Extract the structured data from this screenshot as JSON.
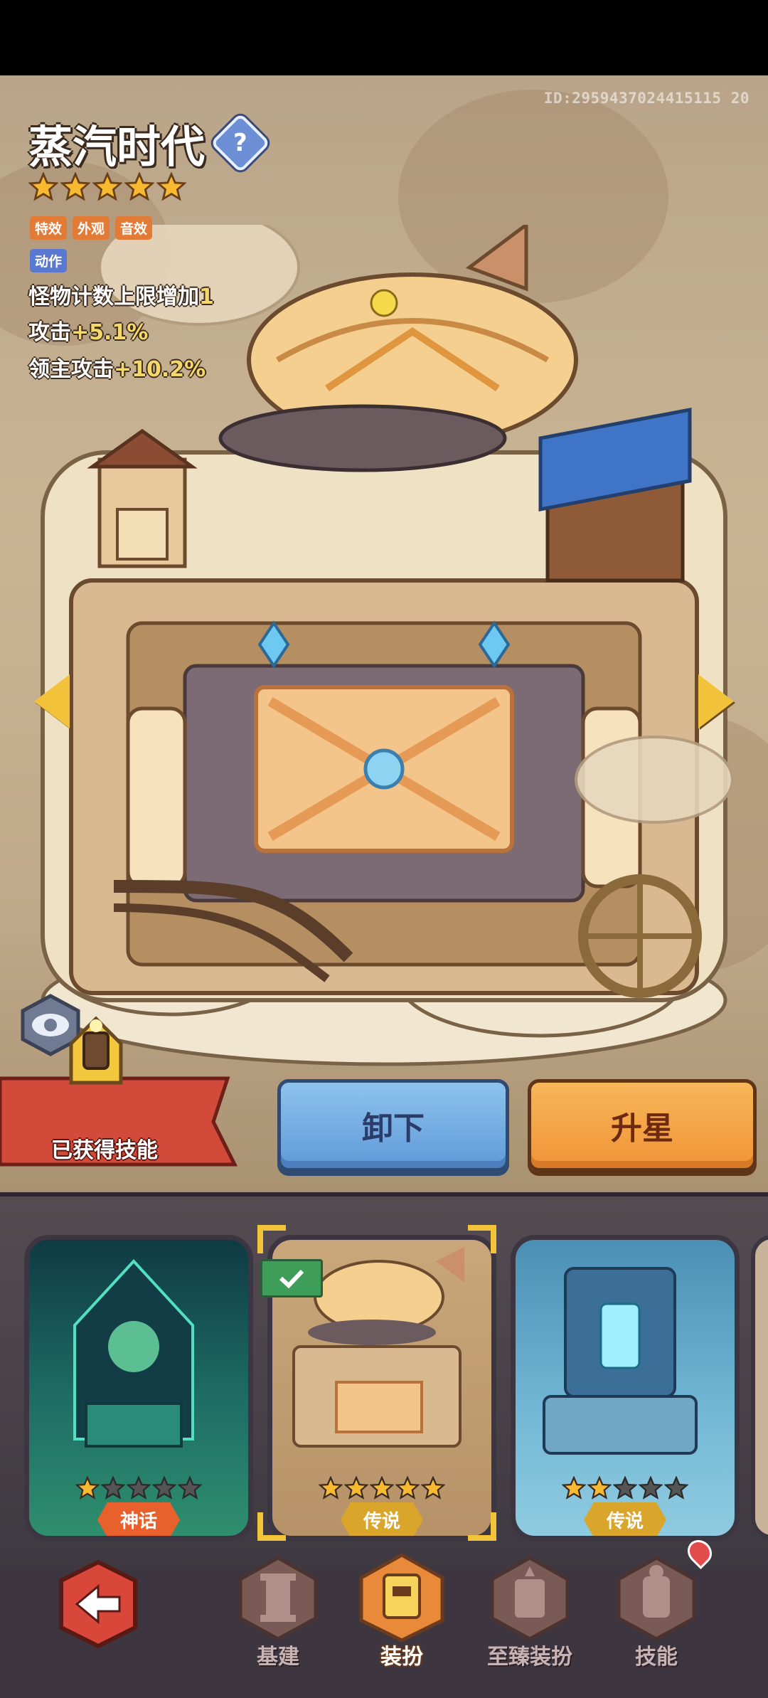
{
  "player_id": "ID:2959437024415115 20",
  "building": {
    "name": "蒸汽时代",
    "stars": 5,
    "tags": [
      "特效",
      "外观",
      "音效"
    ],
    "tag_action": "动作",
    "stats": [
      {
        "label": "怪物计数上限增加",
        "value": "1"
      },
      {
        "label": "攻击",
        "value": "+5.1%"
      },
      {
        "label": "领主攻击",
        "value": "+10.2%"
      }
    ]
  },
  "skill_banner": {
    "label": "已获得技能"
  },
  "buttons": {
    "unequip": "卸下",
    "upgrade": "升星"
  },
  "cards": [
    {
      "name": "card-mythic",
      "rarity": "神话",
      "stars": 1,
      "rarity_color": "#e8612c",
      "bg": "#1e6e66"
    },
    {
      "name": "card-steam-age",
      "rarity": "传说",
      "stars": 5,
      "rarity_color": "#d9a52a",
      "bg": "#c9a77a",
      "selected": true
    },
    {
      "name": "card-cyber",
      "rarity": "传说",
      "stars": 2,
      "rarity_color": "#d9a52a",
      "bg": "#5fa6c9"
    }
  ],
  "nav": [
    {
      "label": "基建",
      "icon": "pillar-icon",
      "active": false
    },
    {
      "label": "装扮",
      "icon": "dress-up-icon",
      "active": true
    },
    {
      "label": "至臻装扮",
      "icon": "supreme-dress-icon",
      "active": false
    },
    {
      "label": "技能",
      "icon": "skill-icon",
      "active": false
    }
  ],
  "colors": {
    "accent": "#f2c33a",
    "nav_bg": "#3d3640",
    "tray_bg": "#554c52"
  }
}
